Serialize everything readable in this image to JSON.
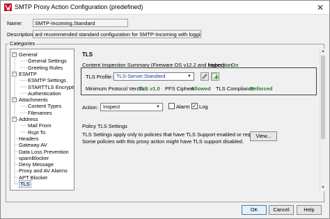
{
  "window": {
    "title": "SMTP Proxy Action Configuration (predefined)",
    "close_glyph": "✕"
  },
  "form": {
    "name_label": "Name:",
    "name_value": "SMTP-Incoming.Standard",
    "description_label": "Description:",
    "description_value": "ard recommended standard configuration for SMTP-Incoming with logging enabled"
  },
  "categories": {
    "title": "Categories",
    "tree": [
      {
        "label": "General",
        "level": 0,
        "toggle": "−"
      },
      {
        "label": "General Settings",
        "level": 1
      },
      {
        "label": "Greeting Rules",
        "level": 1
      },
      {
        "label": "ESMTP",
        "level": 0,
        "toggle": "−"
      },
      {
        "label": "ESMTP Settings",
        "level": 1
      },
      {
        "label": "STARTTLS Encryption",
        "level": 1
      },
      {
        "label": "Authentication",
        "level": 1
      },
      {
        "label": "Attachments",
        "level": 0,
        "toggle": "−"
      },
      {
        "label": "Content Types",
        "level": 1
      },
      {
        "label": "Filenames",
        "level": 1
      },
      {
        "label": "Address",
        "level": 0,
        "toggle": "−"
      },
      {
        "label": "Mail From",
        "level": 1
      },
      {
        "label": "Rcpt To",
        "level": 1
      },
      {
        "label": "Headers",
        "level": 0
      },
      {
        "label": "Gateway AV",
        "level": 0
      },
      {
        "label": "Data Loss Prevention",
        "level": 0
      },
      {
        "label": "spamBlocker",
        "level": 0
      },
      {
        "label": "Deny Message",
        "level": 0
      },
      {
        "label": "Proxy and AV Alarms",
        "level": 0
      },
      {
        "label": "APT Blocker",
        "level": 0
      },
      {
        "label": "TLS",
        "level": 0,
        "selected": true
      }
    ]
  },
  "tls": {
    "heading": "TLS",
    "cis_label": "Content Inspection Summary (Fireware OS v12.2 and higher)",
    "inspection_label": "Inspection",
    "inspection_value": "On",
    "profile_label": "TLS Profile:",
    "profile_value": "TLS-Server.Standard",
    "min_version_label": "Minimum Protocol Version",
    "min_version_value": "TLS v1.0",
    "pfs_label": "PFS Ciphers",
    "pfs_value": "Allowed",
    "compliance_label": "TLS Compliance",
    "compliance_value": "Enforced",
    "action_label": "Action:",
    "action_value": "Inspect",
    "alarm_label": "Alarm",
    "alarm_checked": false,
    "log_label": "Log",
    "log_checked": true,
    "policy_heading": "Policy TLS Settings",
    "policy_text_1": "TLS Settings apply only to policies that have TLS Support enabled or required.",
    "policy_text_2": "Some policies with this proxy action might have TLS support disabled.",
    "view_button": "View..."
  },
  "footer": {
    "ok": "OK",
    "cancel": "Cancel",
    "help": "Help"
  },
  "colors": {
    "accent_green": "#2a7a2a",
    "profile_blue": "#1a3fa0",
    "selection": "#dfe8f5"
  }
}
